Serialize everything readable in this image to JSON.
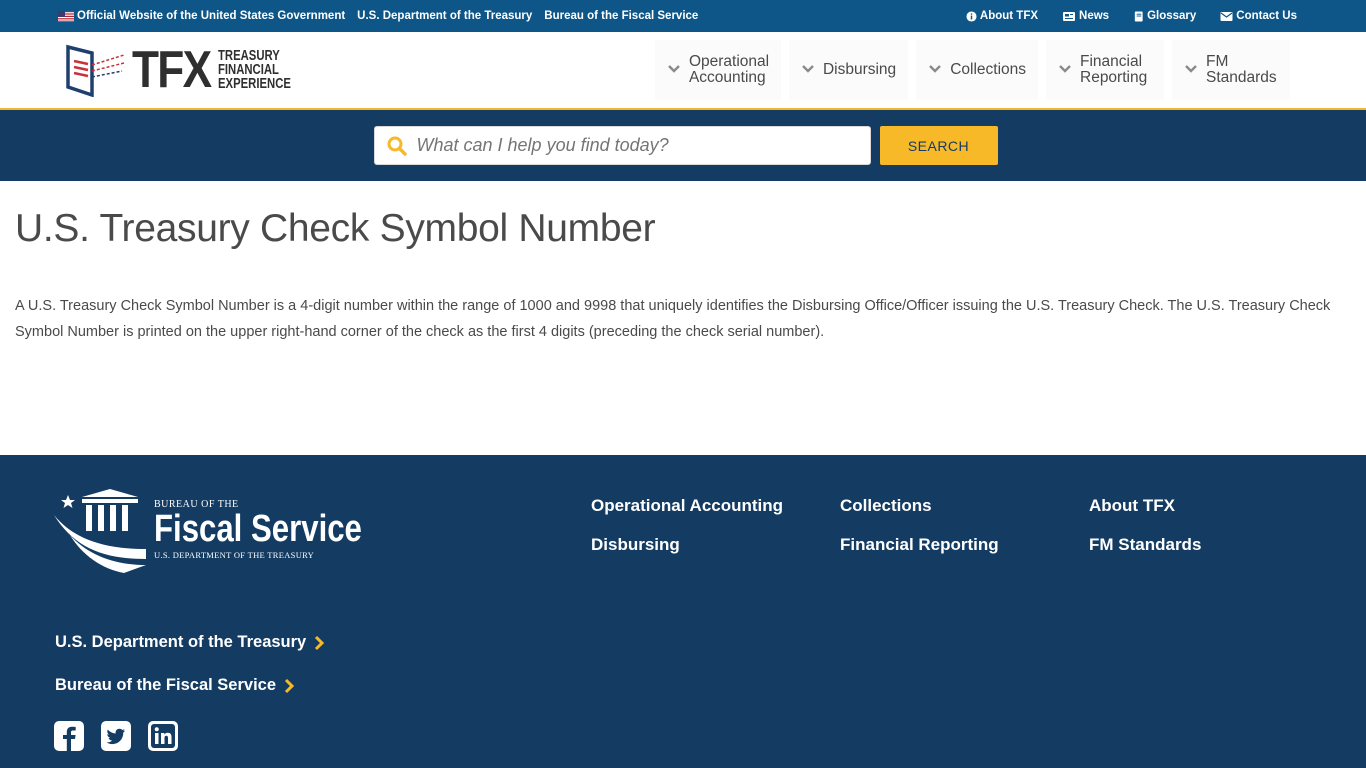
{
  "topbar": {
    "official": "Official Website of the United States Government",
    "treasury": "U.S. Department of the Treasury",
    "bureau": "Bureau of the Fiscal Service",
    "about": "About TFX",
    "news": "News",
    "glossary": "Glossary",
    "contact": "Contact Us"
  },
  "logo": {
    "mark": "TFX",
    "line1": "TREASURY",
    "line2": "FINANCIAL",
    "line3": "EXPERIENCE"
  },
  "nav": {
    "items": [
      {
        "label": "Operational Accounting"
      },
      {
        "label": "Disbursing"
      },
      {
        "label": "Collections"
      },
      {
        "label": "Financial Reporting"
      },
      {
        "label": "FM Standards"
      }
    ]
  },
  "search": {
    "placeholder": "What can I help you find today?",
    "button": "SEARCH"
  },
  "main": {
    "title": "U.S. Treasury Check Symbol Number",
    "body": "A U.S. Treasury Check Symbol Number is a 4-digit number within the range of 1000 and 9998 that uniquely identifies the Disbursing Office/Officer issuing the U.S. Treasury Check. The U.S. Treasury Check Symbol Number is printed on the upper right-hand corner of the check as the first 4 digits (preceding the check serial number)."
  },
  "footer": {
    "logo": {
      "bureau": "BUREAU OF THE",
      "name": "Fiscal Service",
      "dept": "U.S. DEPARTMENT OF THE TREASURY"
    },
    "links": [
      "Operational Accounting",
      "Collections",
      "About TFX",
      "Disbursing",
      "Financial Reporting",
      "FM Standards"
    ],
    "external": {
      "treasury": "U.S. Department of the Treasury",
      "bureau": "Bureau of the Fiscal Service"
    },
    "social": [
      "facebook-icon",
      "twitter-icon",
      "linkedin-icon"
    ]
  },
  "colors": {
    "topbar": "#0f5688",
    "navy": "#143c63",
    "gold": "#f7b928",
    "accent_line": "#f2b52c"
  }
}
